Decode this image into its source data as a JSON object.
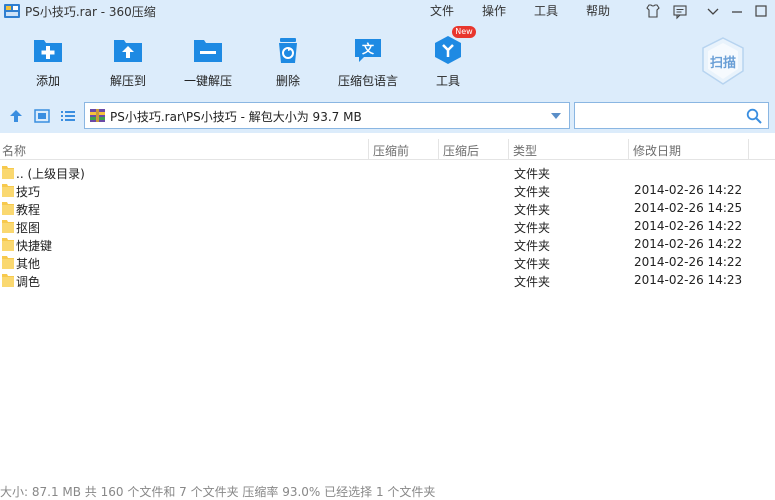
{
  "window": {
    "title": "PS小技巧.rar - 360压缩",
    "menu": [
      "文件",
      "操作",
      "工具",
      "帮助"
    ]
  },
  "toolbar": {
    "items": [
      {
        "label": "添加",
        "icon": "add-icon"
      },
      {
        "label": "解压到",
        "icon": "extract-to-icon"
      },
      {
        "label": "一键解压",
        "icon": "one-click-extract-icon"
      },
      {
        "label": "删除",
        "icon": "delete-icon"
      },
      {
        "label": "压缩包语言",
        "icon": "archive-language-icon"
      },
      {
        "label": "工具",
        "icon": "tools-icon"
      }
    ],
    "new_badge": "New",
    "scan_label": "扫描"
  },
  "address": {
    "path": "PS小技巧.rar\\PS小技巧 - 解包大小为 93.7 MB"
  },
  "search": {
    "placeholder": ""
  },
  "table": {
    "columns": [
      "名称",
      "压缩前",
      "压缩后",
      "类型",
      "修改日期"
    ],
    "rows": [
      {
        "name": ".. (上级目录)",
        "type": "文件夹",
        "date": ""
      },
      {
        "name": "技巧",
        "type": "文件夹",
        "date": "2014-02-26 14:22"
      },
      {
        "name": "教程",
        "type": "文件夹",
        "date": "2014-02-26 14:25"
      },
      {
        "name": "抠图",
        "type": "文件夹",
        "date": "2014-02-26 14:22"
      },
      {
        "name": "快捷键",
        "type": "文件夹",
        "date": "2014-02-26 14:22"
      },
      {
        "name": "其他",
        "type": "文件夹",
        "date": "2014-02-26 14:22"
      },
      {
        "name": "调色",
        "type": "文件夹",
        "date": "2014-02-26 14:23"
      }
    ]
  },
  "status": "大小: 87.1 MB 共 160 个文件和 7 个文件夹 压缩率 93.0% 已经选择 1 个文件夹",
  "colors": {
    "toolbar_bg": "#dcecfb",
    "accent": "#1e8ae3",
    "folder": "#f7c94d"
  }
}
